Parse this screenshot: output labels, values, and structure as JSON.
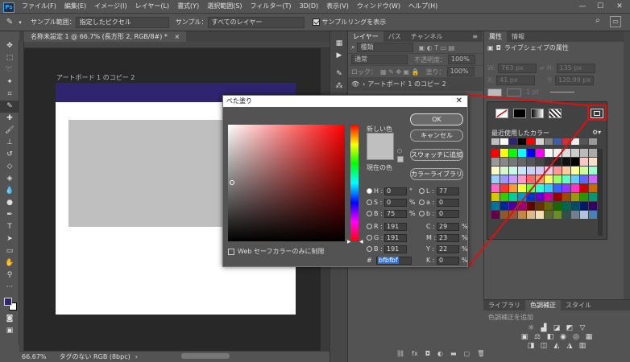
{
  "menubar": {
    "logo": "Ps",
    "items": [
      "ファイル(F)",
      "編集(E)",
      "イメージ(I)",
      "レイヤー(L)",
      "書式(Y)",
      "選択範囲(S)",
      "フィルター(T)",
      "3D(D)",
      "表示(V)",
      "ウィンドウ(W)",
      "ヘルプ(H)"
    ]
  },
  "options_bar": {
    "sample_range_label": "サンプル範囲：",
    "sample_range_value": "指定したピクセル",
    "sample_label": "サンプル：",
    "sample_value": "すべてのレイヤー",
    "sample_ring_label": "サンプルリングを表示"
  },
  "document": {
    "tab_title": "名称未設定 1 @ 66.7% (長方形 2, RGB/8#) *",
    "artboard_label": "アートボード 1 のコピー 2",
    "zoom": "66.67%",
    "status_text": "タグのない RGB (8bpc)"
  },
  "layers_panel": {
    "tabs": [
      "レイヤー",
      "パス",
      "チャンネル"
    ],
    "search_placeholder": "種類",
    "blend_mode": "通常",
    "opacity_label": "不透明度：",
    "opacity_value": "100%",
    "lock_label": "ロック：",
    "fill_label": "塗り：",
    "fill_value": "100%",
    "layer_name": "アートボード 1 のコピー 2"
  },
  "properties_panel": {
    "tabs": [
      "属性",
      "情報"
    ],
    "subtitle": "ライブシェイプの属性",
    "w_label": "W:",
    "w_value": "763 px",
    "h_label": "H:",
    "h_value": "135 px",
    "x_label": "X:",
    "x_value": "41 px",
    "y_label": "Y:",
    "y_value": "120.99 px",
    "stroke_value": "1 pt"
  },
  "swatch_popup": {
    "recent_label": "最近使用したカラー",
    "recent_colors": [
      "#bfbfbf",
      "#ffffff",
      "#2e2470",
      "#000000",
      "#ff0000",
      "#d4d4d4",
      "#7f7f7f",
      "#3b5ea8",
      "#cc3333",
      "#eeeeee",
      "#555555",
      "#999999"
    ],
    "grid_colors": [
      "#ff0000",
      "#ffff00",
      "#00ff00",
      "#00ffff",
      "#0000ff",
      "#ff00ff",
      "#ffffff",
      "#eeeeee",
      "#dddddd",
      "#cccccc",
      "#bbbbbb",
      "#aaaaaa",
      "#999999",
      "#888888",
      "#777777",
      "#666666",
      "#555555",
      "#444444",
      "#333333",
      "#222222",
      "#111111",
      "#000000",
      "#f8c8c8",
      "#f8e0c8",
      "#f8f8c8",
      "#d8f8c8",
      "#c8f8e8",
      "#c8e8f8",
      "#c8d0f8",
      "#d8c8f8",
      "#f8c8e8",
      "#ff9999",
      "#ffcc99",
      "#ffff99",
      "#ccff99",
      "#99ffcc",
      "#99ccff",
      "#9999ff",
      "#cc99ff",
      "#ff99cc",
      "#ff6666",
      "#ff9966",
      "#ffff66",
      "#99ff66",
      "#66ffcc",
      "#66ccff",
      "#6666ff",
      "#cc66ff",
      "#ff66cc",
      "#ff3333",
      "#ff9933",
      "#ffff33",
      "#66ff33",
      "#33ffcc",
      "#33ccff",
      "#3366ff",
      "#9933ff",
      "#ff33cc",
      "#cc0000",
      "#cc6600",
      "#cccc00",
      "#33cc00",
      "#00cc99",
      "#0099cc",
      "#0033cc",
      "#6600cc",
      "#cc0099",
      "#990000",
      "#994c00",
      "#999900",
      "#269900",
      "#009973",
      "#007399",
      "#002699",
      "#4c0099",
      "#990073",
      "#660000",
      "#663300",
      "#666600",
      "#1a6600",
      "#00664d",
      "#004d66",
      "#001a66",
      "#330066",
      "#66004d",
      "#8b5a2b",
      "#a0522d",
      "#c68642",
      "#deb887",
      "#f5deb3",
      "#556b2f",
      "#6b8e23",
      "#2f4f4f",
      "#708090",
      "#b0c4de",
      "#4682b4"
    ]
  },
  "adjustments_panel": {
    "tabs": [
      "ライブラリ",
      "色調補正",
      "スタイル"
    ],
    "add_label": "色調補正を追加"
  },
  "color_dialog": {
    "title": "べた塗り",
    "new_label": "新しい色",
    "current_label": "現在の色",
    "ok": "OK",
    "cancel": "キャンセル",
    "add_swatch": "スウォッチに追加",
    "color_libraries": "カラーライブラリ",
    "web_safe_label": "Web セーフカラーのみに制限",
    "H_label": "H :",
    "H_value": "0",
    "H_unit": "°",
    "S_label": "S :",
    "S_value": "0",
    "S_unit": "%",
    "Bv_label": "B :",
    "Bv_value": "75",
    "Bv_unit": "%",
    "R_label": "R :",
    "R_value": "191",
    "G_label": "G :",
    "G_value": "191",
    "B_label": "B :",
    "B_value": "191",
    "L_label": "L :",
    "L_value": "77",
    "a_label": "a :",
    "a_value": "0",
    "b_label": "b :",
    "b_value": "0",
    "C_label": "C :",
    "C_value": "29",
    "C_unit": "%",
    "M_label": "M :",
    "M_value": "23",
    "M_unit": "%",
    "Y_label": "Y :",
    "Y_value": "22",
    "Y_unit": "%",
    "K_label": "K :",
    "K_value": "0",
    "K_unit": "%",
    "hex_label": "#",
    "hex_value": "bfbfbf",
    "new_color": "#bfbfbf",
    "current_color": "#bfbfbf"
  },
  "colors": {
    "highlight": "#e01010",
    "artboard_band": "#2e2470",
    "foreground": "#2e2470"
  }
}
